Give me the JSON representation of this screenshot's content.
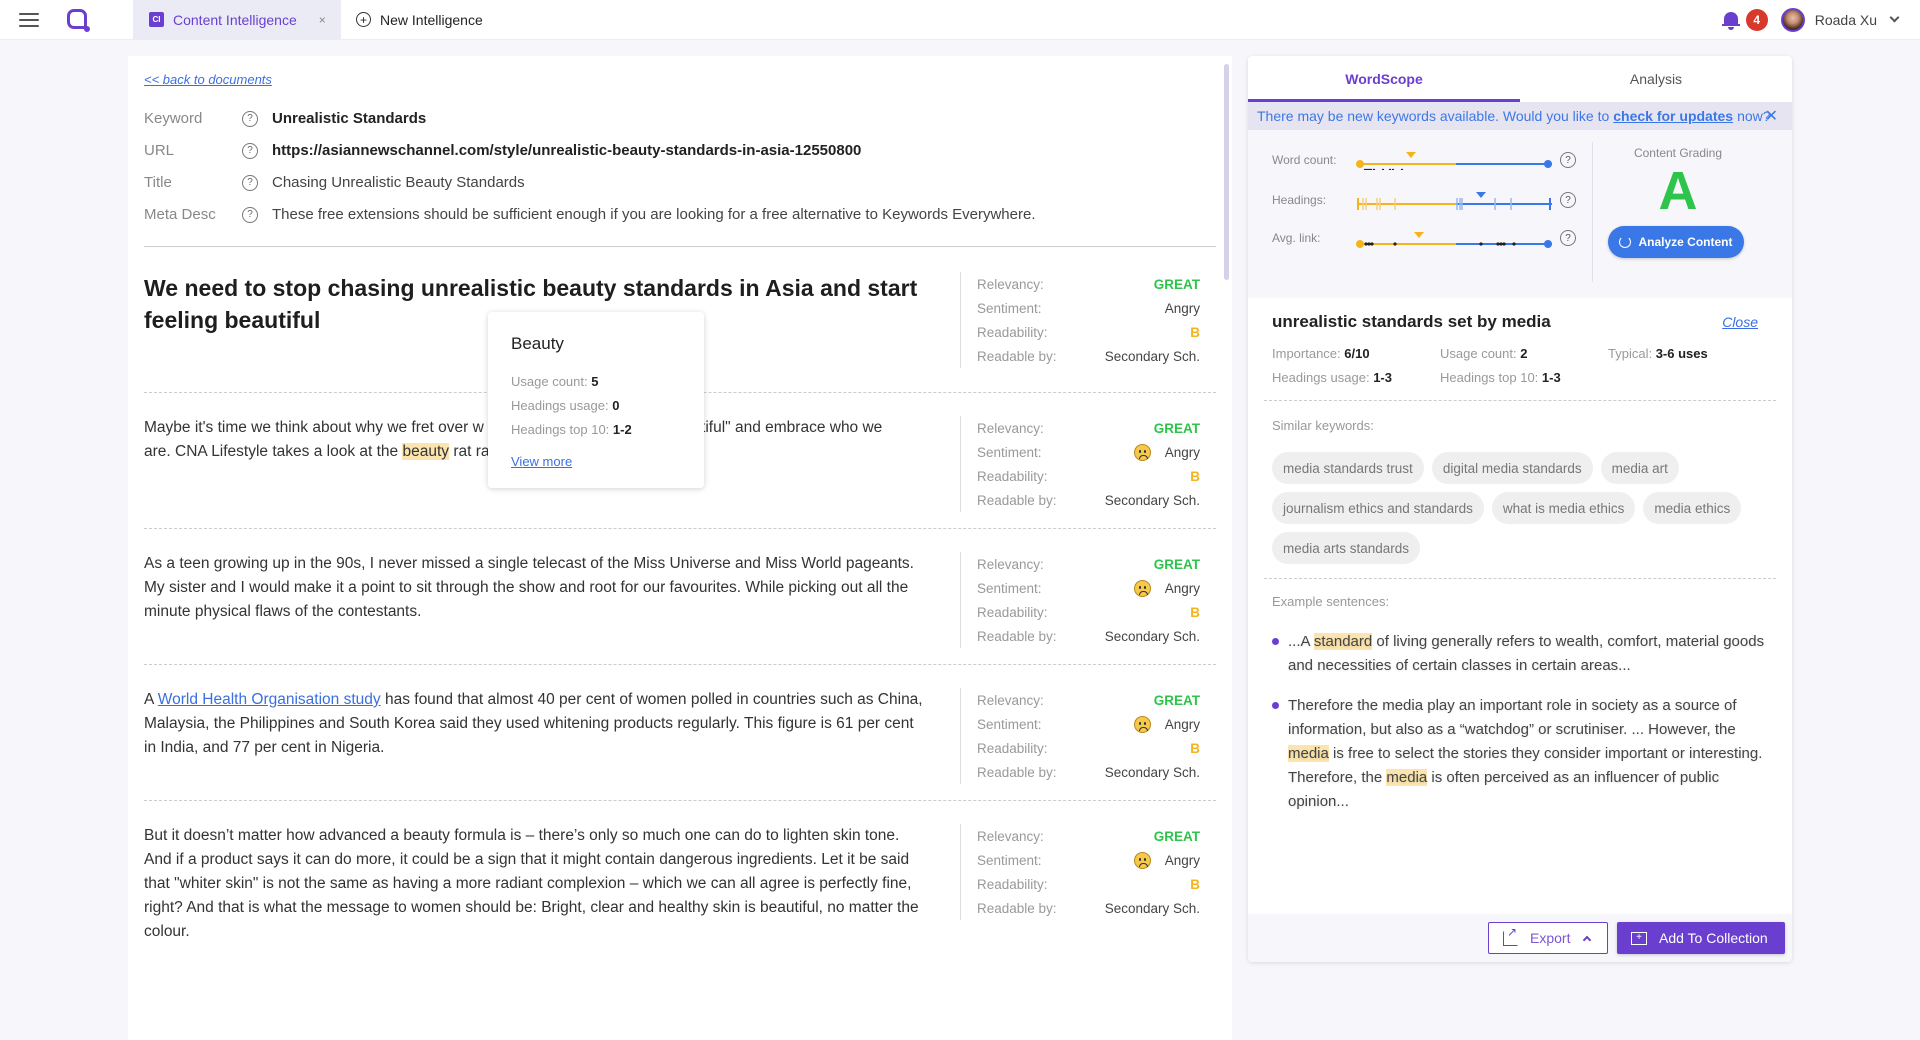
{
  "topbar": {
    "tabs": [
      {
        "badge": "CI",
        "label": "Content Intelligence",
        "close": "×",
        "active": true
      },
      {
        "icon": "+",
        "label": "New Intelligence",
        "active": false
      }
    ],
    "notification_count": "4",
    "user_name": "Roada Xu"
  },
  "document": {
    "back_link": "<< back to documents",
    "meta": [
      {
        "key": "Keyword",
        "value": "Unrealistic Standards"
      },
      {
        "key": "URL",
        "value": "https://asiannewschannel.com/style/unrealistic-beauty-standards-in-asia-12550800"
      },
      {
        "key": "Title",
        "value": "Chasing Unrealistic Beauty Standards"
      },
      {
        "key": "Meta Desc",
        "value": "These free extensions should be sufficient enough if you are looking for a free alternative to Keywords Everywhere."
      }
    ],
    "sections": [
      {
        "heading": "We need to stop chasing unrealistic beauty standards in Asia and start feeling beautiful"
      },
      {
        "before": "Maybe it's time we think about why we fret over w",
        "after_tooltip": "autiful\" and embrace who we",
        "line2_before": "are. CNA Lifestyle takes a look at the ",
        "highlight": "beauty",
        "line2_after": " rat ra"
      },
      {
        "text": "As a teen growing up in the 90s, I never missed a single telecast of the Miss Universe and Miss World pageants. My sister and I would make it a point to sit through the show and root for our favourites. While picking out all the minute physical flaws of the contestants."
      },
      {
        "prefix": "A ",
        "link": "World Health Organisation study",
        "text": " has found that almost 40 per cent of women polled in countries such as China, Malaysia, the Philippines and South Korea said they used whitening products regularly. This figure is 61 per cent in India, and 77 per cent in Nigeria."
      },
      {
        "text": "But it doesn’t matter how advanced a beauty formula is – there’s only so much one can do to lighten skin tone. And if a product says it can do more, it could be a sign that it might contain dangerous ingredients. Let it be said that \"whiter skin\" is not the same as having a more radiant complexion – which we can all agree is perfectly fine, right? And that is what the message to women should be: Bright, clear and healthy skin is beautiful, no matter the colour."
      }
    ],
    "stat_labels": {
      "relevancy": "Relevancy:",
      "sentiment": "Sentiment:",
      "readability": "Readability:",
      "readable_by": "Readable by:"
    },
    "stats": [
      {
        "relevancy": "GREAT",
        "sentiment": "Angry",
        "readability": "B",
        "readable_by": "Secondary Sch.",
        "emoji": false
      },
      {
        "relevancy": "GREAT",
        "sentiment": "Angry",
        "readability": "B",
        "readable_by": "Secondary Sch.",
        "emoji": true
      },
      {
        "relevancy": "GREAT",
        "sentiment": "Angry",
        "readability": "B",
        "readable_by": "Secondary Sch.",
        "emoji": true
      },
      {
        "relevancy": "GREAT",
        "sentiment": "Angry",
        "readability": "B",
        "readable_by": "Secondary Sch.",
        "emoji": true
      },
      {
        "relevancy": "GREAT",
        "sentiment": "Angry",
        "readability": "B",
        "readable_by": "Secondary Sch.",
        "emoji": true
      }
    ],
    "tooltip": {
      "title": "Beauty",
      "usage_label": "Usage count: ",
      "usage_value": "5",
      "headings_label": "Headings usage: ",
      "headings_value": "0",
      "top10_label": "Headings top 10: ",
      "top10_value": "1-2",
      "link": "View more"
    }
  },
  "wordscope": {
    "tabs": [
      "WordScope",
      "Analysis"
    ],
    "notice": {
      "before": "There may be new keywords available. Would you like to",
      "link": "check for updates",
      "after": "now?",
      "close": "✕"
    },
    "metrics": [
      {
        "label": "Word count:"
      },
      {
        "label": "Headings:"
      },
      {
        "label": "Avg. link:"
      }
    ],
    "grading": {
      "label": "Content Grading",
      "grade": "A",
      "button": "Analyze Content"
    },
    "keyword": {
      "title": "unrealistic standards set by media",
      "close": "Close",
      "importance_label": "Importance: ",
      "importance": "6/10",
      "usage_label": "Usage count: ",
      "usage": "2",
      "typical_label": "Typical: ",
      "typical": "3-6 uses",
      "headings_label": "Headings usage: ",
      "headings": "1-3",
      "top10_label": "Headings top 10: ",
      "top10": "1-3"
    },
    "similar_label": "Similar keywords:",
    "similar": [
      "media standards trust",
      "digital media standards",
      "media art",
      "journalism ethics and standards",
      "what is media ethics",
      "media ethics",
      "media arts standards"
    ],
    "examples_label": "Example sentences:",
    "examples": [
      {
        "pre": "...A ",
        "hl": "standard",
        "post": " of living generally refers to wealth, comfort, material goods and necessities of certain classes in certain areas..."
      },
      {
        "pre": "Therefore the media play an important role in society as a source of information, but also as a “watchdog” or scrutiniser. ... However, the ",
        "hl": "media",
        "mid": " is free to select the stories they consider important or interesting. Therefore, the ",
        "hl2": "media",
        "post": " is often perceived as an influencer of public opinion..."
      }
    ],
    "footer": {
      "export": "Export",
      "add": "Add To Collection"
    }
  },
  "colors": {
    "accent": "#6a3fd0",
    "blue": "#3b78e7",
    "great": "#2ec44c",
    "grade_b": "#f5b41b",
    "highlight": "#fbe4ad"
  }
}
